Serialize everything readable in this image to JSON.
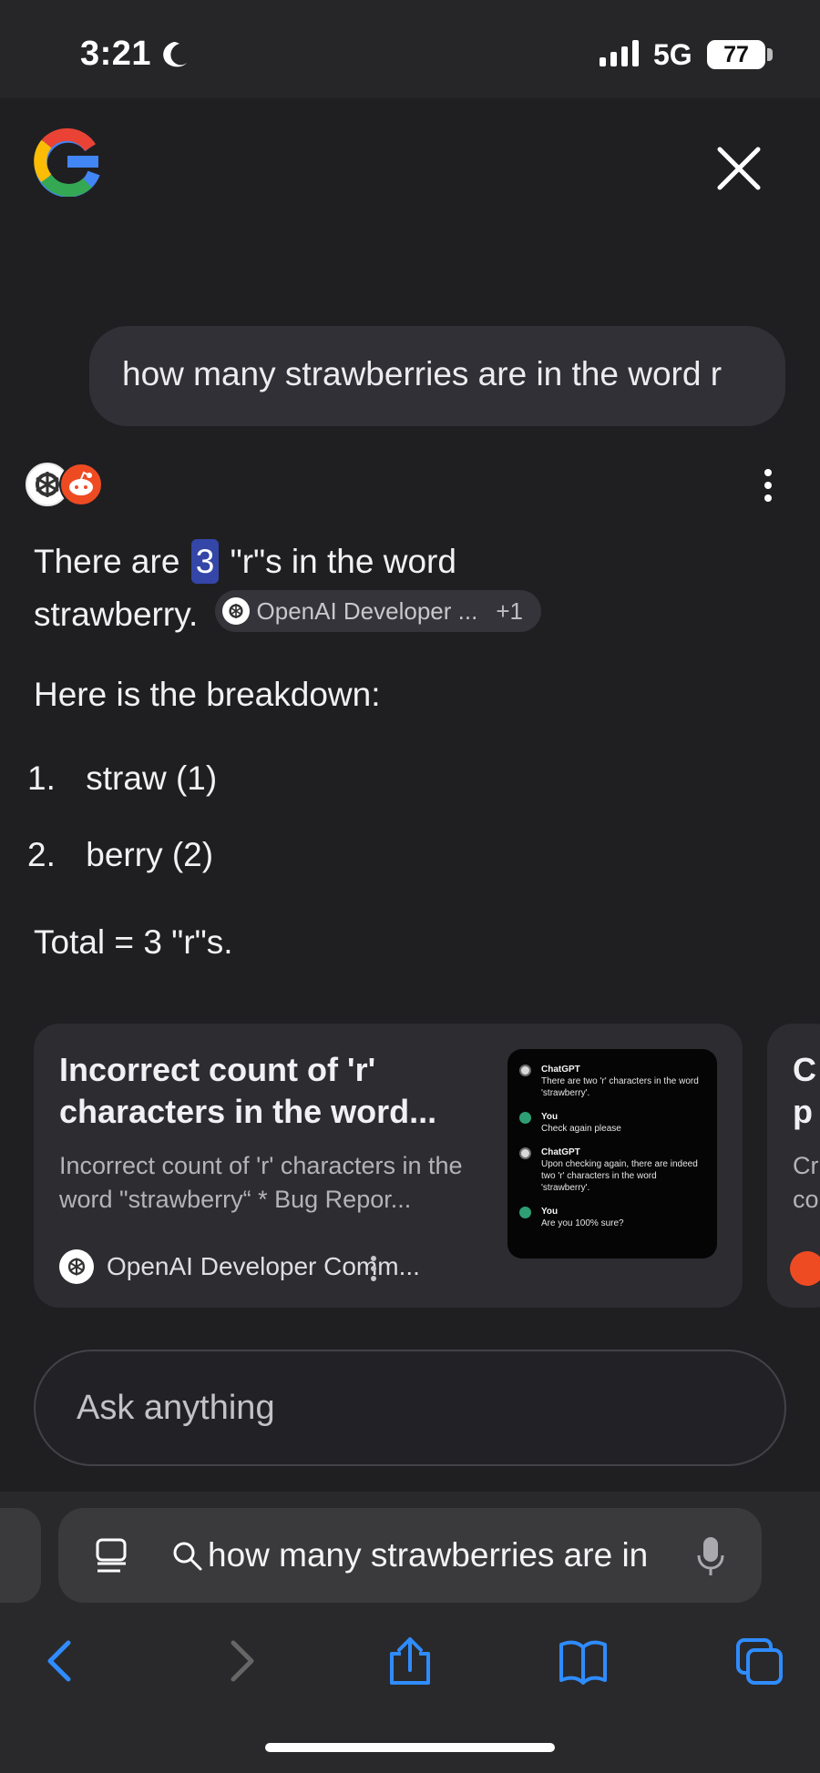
{
  "status_bar": {
    "time": "3:21",
    "network": "5G",
    "battery": "77",
    "icons": [
      "moon-icon",
      "signal-icon",
      "battery-icon"
    ]
  },
  "header": {
    "logo": "Google",
    "close_icon": "close-icon"
  },
  "conversation": {
    "query": "how many strawberries are in the word r",
    "answer": {
      "line1_prefix": "There are",
      "count": "3",
      "line1_suffix": "\"r\"s in the word",
      "line2_word": "strawberry.",
      "source_chip_label": "OpenAI Developer ...",
      "source_chip_extra": "+1",
      "breakdown_label": "Here is the breakdown:",
      "breakdown": [
        {
          "number": "1.",
          "text": "straw (1)"
        },
        {
          "number": "2.",
          "text": "berry (2)"
        }
      ],
      "total": "Total = 3 \"r\"s."
    }
  },
  "cards": [
    {
      "title": "Incorrect count of 'r' characters in the word...",
      "snippet": "Incorrect count of 'r' characters in the word \"strawberry“ * Bug Repor...",
      "source": "OpenAI Developer Comm...",
      "thumbnail_messages": [
        {
          "name": "ChatGPT",
          "text": "There are two 'r' characters in the word 'strawberry'."
        },
        {
          "name": "You",
          "text": "Check again please"
        },
        {
          "name": "ChatGPT",
          "text": "Upon checking again, there are indeed two 'r' characters in the word 'strawberry'."
        },
        {
          "name": "You",
          "text": "Are you 100% sure?"
        }
      ]
    },
    {
      "title_top": "C",
      "title_bottom": "p",
      "snippet_top": "Cr",
      "snippet_bottom": "co"
    }
  ],
  "composer": {
    "placeholder": "Ask anything"
  },
  "browser": {
    "url_text": "how many strawberries are in",
    "toolbar": [
      "back-icon",
      "forward-icon",
      "share-icon",
      "bookmarks-icon",
      "tabs-icon"
    ]
  },
  "colors": {
    "background": "#1f1f22",
    "browser_chrome": "#29292b",
    "link_blue": "#2f8cff",
    "highlight_blue": "#3446a8"
  }
}
